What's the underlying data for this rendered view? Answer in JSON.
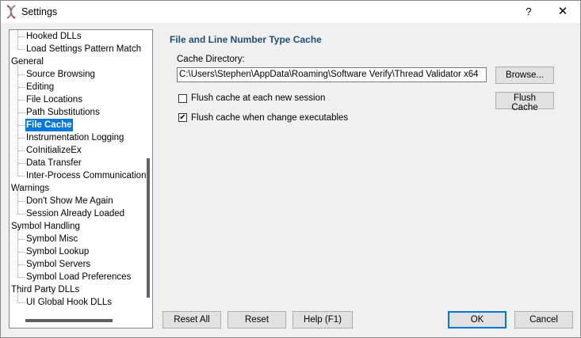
{
  "window": {
    "title": "Settings",
    "help_glyph": "?",
    "close_glyph": "✕"
  },
  "tree": [
    {
      "label": "Hooked DLLs",
      "level": 1
    },
    {
      "label": "Load Settings Pattern Match",
      "level": 1
    },
    {
      "label": "General",
      "level": 0
    },
    {
      "label": "Source Browsing",
      "level": 1
    },
    {
      "label": "Editing",
      "level": 1
    },
    {
      "label": "File Locations",
      "level": 1
    },
    {
      "label": "Path Substitutions",
      "level": 1
    },
    {
      "label": "File Cache",
      "level": 1,
      "selected": true
    },
    {
      "label": "Instrumentation Logging",
      "level": 1
    },
    {
      "label": "CoInitializeEx",
      "level": 1
    },
    {
      "label": "Data Transfer",
      "level": 1
    },
    {
      "label": "Inter-Process Communication",
      "level": 1
    },
    {
      "label": "Warnings",
      "level": 0
    },
    {
      "label": "Don't Show Me Again",
      "level": 1
    },
    {
      "label": "Session Already Loaded",
      "level": 1
    },
    {
      "label": "Symbol Handling",
      "level": 0
    },
    {
      "label": "Symbol Misc",
      "level": 1
    },
    {
      "label": "Symbol Lookup",
      "level": 1
    },
    {
      "label": "Symbol Servers",
      "level": 1
    },
    {
      "label": "Symbol Load Preferences",
      "level": 1
    },
    {
      "label": "Third Party DLLs",
      "level": 0
    },
    {
      "label": "UI Global Hook DLLs",
      "level": 1
    }
  ],
  "panel": {
    "title": "File and Line Number Type Cache",
    "cache_dir_label": "Cache Directory:",
    "cache_dir_value": "C:\\Users\\Stephen\\AppData\\Roaming\\Software Verify\\Thread Validator x64",
    "browse_label": "Browse...",
    "flush_cache_label": "Flush Cache",
    "flush_each_session_label": "Flush cache at each new session",
    "flush_each_session_checked": false,
    "flush_change_exe_label": "Flush cache when change executables",
    "flush_change_exe_checked": true
  },
  "footer": {
    "reset_all_label": "Reset All",
    "reset_label": "Reset",
    "help_label": "Help (F1)",
    "ok_label": "OK",
    "cancel_label": "Cancel"
  }
}
